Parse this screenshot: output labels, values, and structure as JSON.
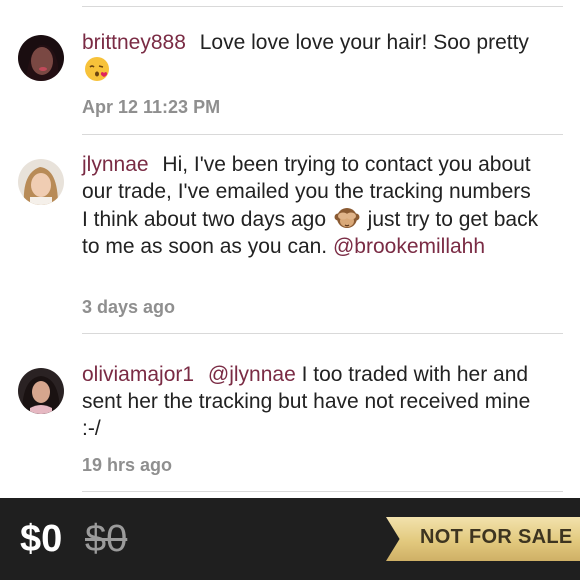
{
  "comments": [
    {
      "username": "brittney888",
      "text_before": "Love love love your hair! Soo pretty",
      "emoji": "kissing-face-emoji",
      "text_after": "",
      "mention": "",
      "timestamp": "Apr 12 11:23 PM"
    },
    {
      "username": "jlynnae",
      "text_before": "Hi, I've been trying to contact you about our trade, I've emailed you the tracking numbers I think about two days ago",
      "emoji": "see-no-evil-monkey-emoji",
      "text_after": " just try to get back to me as soon as you can.",
      "mention": "@brookemillahh",
      "timestamp": "3 days ago"
    },
    {
      "username": "oliviamajor1",
      "mention": "@jlynnae",
      "text": "I too traded with her and sent her the tracking but have not received mine :-/",
      "timestamp": "19 hrs ago"
    }
  ],
  "footer": {
    "price": "$0",
    "original_price": "$0",
    "status_badge": "NOT FOR SALE"
  }
}
